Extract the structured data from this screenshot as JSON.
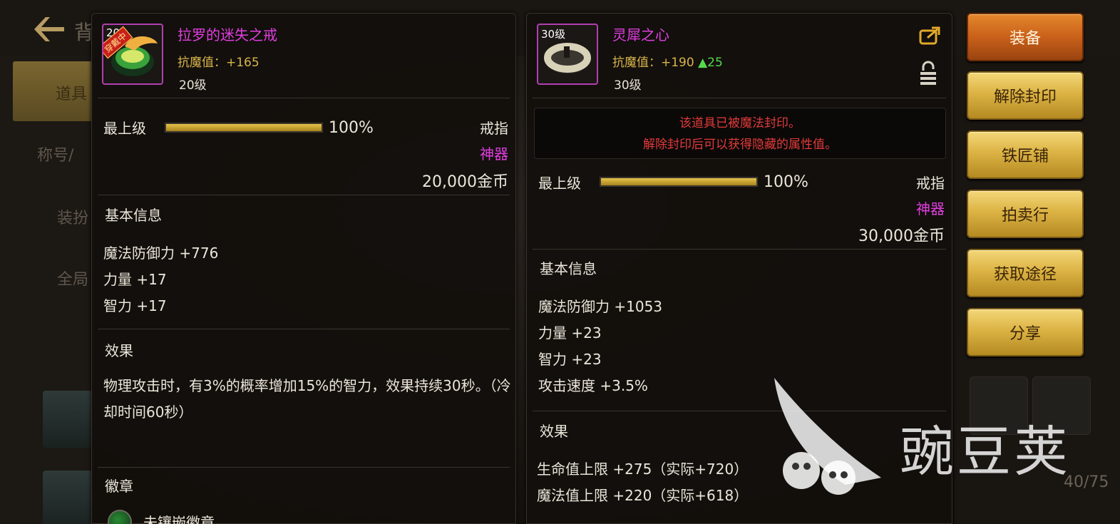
{
  "background": {
    "title": "背",
    "tabs": [
      "道具",
      "称号/",
      "装扮",
      "全局"
    ],
    "inventory_count": "40/75"
  },
  "left_item": {
    "name": "拉罗的迷失之戒",
    "stat": "抗魔值：+165",
    "level": "20级",
    "worn_badge": "穿戴中",
    "slot_level": "20",
    "grade_label": "最上级",
    "grade_percent": "100%",
    "grade_fraction": 1.0,
    "type": "戒指",
    "rarity": "神器",
    "price": "20,000金币",
    "basic_info_title": "基本信息",
    "basic_stats": [
      "魔法防御力 +776",
      "力量 +17",
      "智力 +17"
    ],
    "effect_title": "效果",
    "effect_text": "物理攻击时，有3%的概率增加15%的智力，效果持续30秒。（冷却时间60秒）",
    "emblem_title": "徽章",
    "emblem_text": "未镶嵌徽章。"
  },
  "right_item": {
    "name": "灵犀之心",
    "slot_level": "30级",
    "stat": "抗魔值：+190",
    "stat_delta": "▲25",
    "level": "30级",
    "seal_notice_1": "该道具已被魔法封印。",
    "seal_notice_2": "解除封印后可以获得隐藏的属性值。",
    "grade_label": "最上级",
    "grade_percent": "100%",
    "grade_fraction": 1.0,
    "type": "戒指",
    "rarity": "神器",
    "price": "30,000金币",
    "basic_info_title": "基本信息",
    "basic_stats": [
      "魔法防御力 +1053",
      "力量 +23",
      "智力 +23",
      "攻击速度 +3.5%"
    ],
    "effect_title": "效果",
    "effect_stats": [
      "生命值上限 +275（实际+720）",
      "魔法值上限 +220（实际+618）"
    ]
  },
  "actions": {
    "equip": "装备",
    "unseal": "解除封印",
    "blacksmith": "铁匠铺",
    "auction": "拍卖行",
    "obtain": "获取途径",
    "share": "分享"
  },
  "watermark": {
    "text": "豌豆荚"
  },
  "colors": {
    "rarity_purple": "#e23ee0",
    "stat_gold": "#d8b54a",
    "seal_red": "#e23a3a",
    "increase_green": "#57d84d",
    "button_gold": "#dcb344",
    "button_orange": "#c9601a"
  },
  "icons": {
    "back": "back-arrow-icon",
    "share": "share-arrow-icon",
    "lock": "lock-icon"
  }
}
